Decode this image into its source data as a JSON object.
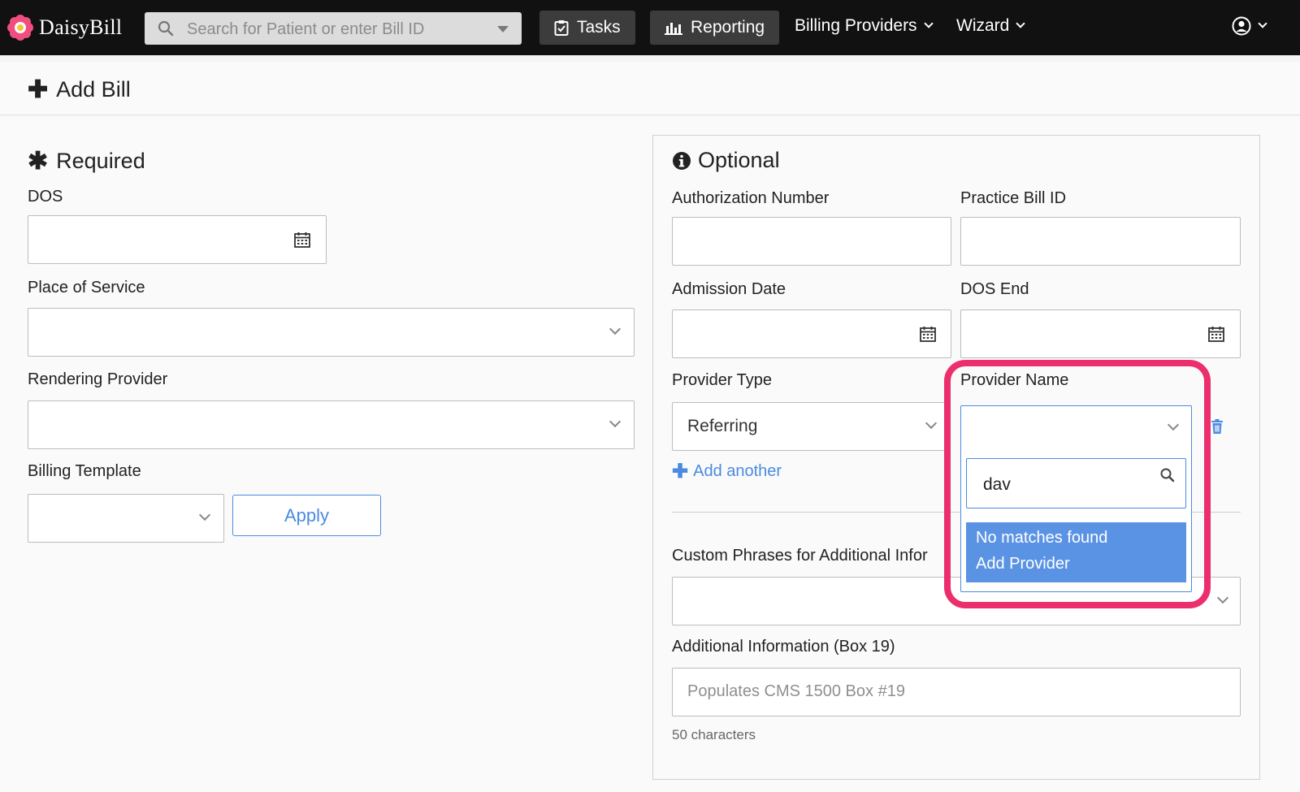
{
  "nav": {
    "logo_text": "DaisyBill",
    "search_placeholder": "Search for Patient or enter Bill ID",
    "tasks_label": "Tasks",
    "reporting_label": "Reporting",
    "billing_providers_label": "Billing Providers",
    "wizard_label": "Wizard"
  },
  "page": {
    "title": "Add Bill"
  },
  "required": {
    "title": "Required",
    "dos_label": "DOS",
    "place_of_service_label": "Place of Service",
    "rendering_provider_label": "Rendering Provider",
    "billing_template_label": "Billing Template",
    "apply_label": "Apply"
  },
  "optional": {
    "title": "Optional",
    "authorization_number_label": "Authorization Number",
    "practice_bill_id_label": "Practice Bill ID",
    "admission_date_label": "Admission Date",
    "dos_end_label": "DOS End",
    "provider_type_label": "Provider Type",
    "provider_type_value": "Referring",
    "provider_name_label": "Provider Name",
    "add_another_label": "Add another",
    "custom_phrases_label": "Custom Phrases for Additional Infor",
    "additional_info_label": "Additional Information (Box 19)",
    "additional_info_placeholder": "Populates CMS 1500 Box #19",
    "char_count": "50 characters"
  },
  "provider_dropdown": {
    "search_value": "dav",
    "results": [
      "No matches found",
      "Add Provider"
    ]
  },
  "colors": {
    "accent": "#4a8be0",
    "highlight": "#ec2f6c",
    "topbar": "#111111",
    "result_bg": "#5b93e4"
  }
}
